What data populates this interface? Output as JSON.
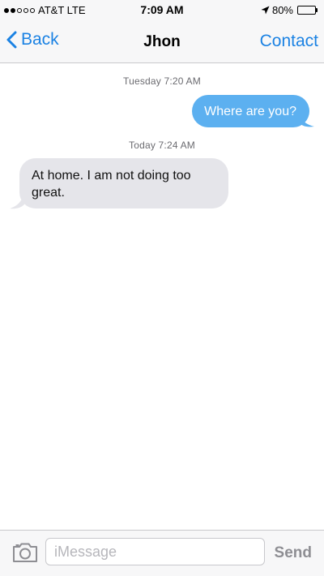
{
  "status_bar": {
    "carrier": "AT&T LTE",
    "signal_bars_filled": 2,
    "signal_bars_total": 5,
    "time": "7:09 AM",
    "battery": "80%",
    "battery_level": 0.8,
    "icons": [
      "signal-dots-icon",
      "location-arrow-icon",
      "battery-icon"
    ]
  },
  "nav": {
    "back_label": "Back",
    "title": "Jhon",
    "contact_label": "Contact"
  },
  "conversation": {
    "messages": [
      {
        "timestamp": "Tuesday 7:20 AM",
        "direction": "outgoing",
        "text": "Where are you?"
      },
      {
        "timestamp": "Today 7:24 AM",
        "direction": "incoming",
        "text": "At home. I am not doing too great."
      }
    ]
  },
  "input_bar": {
    "camera_icon": "camera-icon",
    "placeholder": "iMessage",
    "value": "",
    "send_label": "Send"
  },
  "colors": {
    "accent": "#1b82e3",
    "outgoing_bubble": "#5cb0f0",
    "incoming_bubble": "#e5e5ea",
    "bar_background": "#f7f7f8"
  }
}
